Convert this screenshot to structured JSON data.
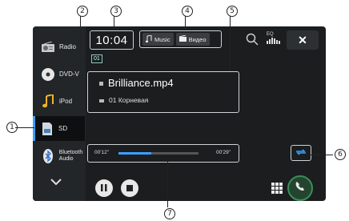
{
  "sidebar": {
    "items": [
      {
        "label": "Radio",
        "icon": "radio-icon"
      },
      {
        "label": "DVD-V",
        "icon": "disc-icon"
      },
      {
        "label": "iPod",
        "icon": "music-note-icon"
      },
      {
        "label": "SD",
        "icon": "sd-card-icon"
      },
      {
        "label": "Bluetooth Audio",
        "icon": "bluetooth-icon"
      }
    ]
  },
  "header": {
    "clock": "10:04",
    "track_number": "01",
    "tabs": [
      {
        "label": "Music",
        "icon": "music-icon"
      },
      {
        "label": "Видео",
        "icon": "video-icon"
      }
    ],
    "eq_label": "EQ"
  },
  "info": {
    "file": "Brilliance.mp4",
    "folder": "01 Корневая"
  },
  "playback": {
    "elapsed": "00'12\"",
    "total": "00'29\"",
    "progress_fraction": 0.41
  },
  "callouts": [
    "1",
    "2",
    "3",
    "4",
    "5",
    "6",
    "7"
  ]
}
